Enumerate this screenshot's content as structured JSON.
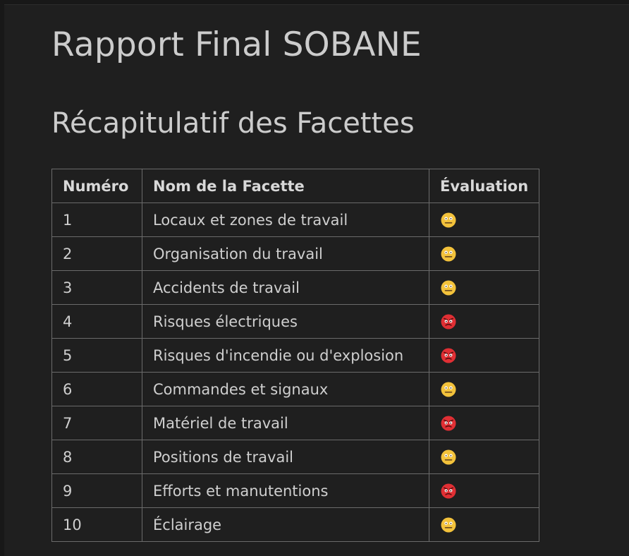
{
  "report": {
    "title": "Rapport Final SOBANE",
    "subtitle": "Récapitulatif des Facettes"
  },
  "table": {
    "headers": {
      "number": "Numéro",
      "name": "Nom de la Facette",
      "evaluation": "Évaluation"
    },
    "rows": [
      {
        "number": "1",
        "name": "Locaux et zones de travail",
        "evaluation": "neutral-face-icon"
      },
      {
        "number": "2",
        "name": "Organisation du travail",
        "evaluation": "neutral-face-icon"
      },
      {
        "number": "3",
        "name": "Accidents de travail",
        "evaluation": "neutral-face-icon"
      },
      {
        "number": "4",
        "name": "Risques électriques",
        "evaluation": "angry-face-icon"
      },
      {
        "number": "5",
        "name": "Risques d'incendie ou d'explosion",
        "evaluation": "angry-face-icon"
      },
      {
        "number": "6",
        "name": "Commandes et signaux",
        "evaluation": "neutral-face-icon"
      },
      {
        "number": "7",
        "name": "Matériel de travail",
        "evaluation": "angry-face-icon"
      },
      {
        "number": "8",
        "name": "Positions de travail",
        "evaluation": "neutral-face-icon"
      },
      {
        "number": "9",
        "name": "Efforts et manutentions",
        "evaluation": "angry-face-icon"
      },
      {
        "number": "10",
        "name": "Éclairage",
        "evaluation": "neutral-face-icon"
      }
    ]
  },
  "colors": {
    "background": "#1f1f1f",
    "text": "#d4d4d4",
    "neutral_face": "#f3c23b",
    "angry_face": "#e02f34"
  }
}
